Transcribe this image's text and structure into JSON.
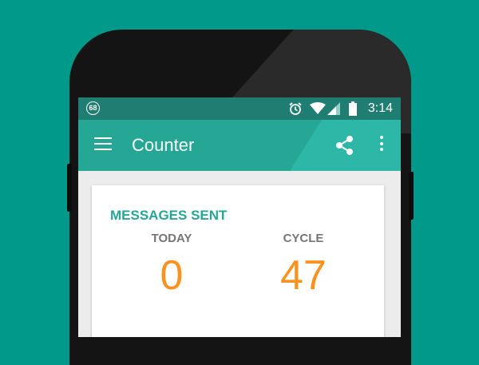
{
  "statusbar": {
    "notification_count": "68",
    "time": "3:14"
  },
  "appbar": {
    "title": "Counter"
  },
  "card": {
    "heading": "MESSAGES SENT",
    "today_label": "TODAY",
    "today_value": "0",
    "cycle_label": "CYCLE",
    "cycle_value": "47"
  },
  "colors": {
    "background": "#00998a",
    "statusbar": "#1f7d72",
    "appbar": "#26a694",
    "heading": "#26a694",
    "value": "#f7931e"
  },
  "icons": {
    "statusbar": [
      "notification-badge-icon",
      "alarm-icon",
      "wifi-icon",
      "signal-icon",
      "battery-icon"
    ],
    "appbar": [
      "menu-icon",
      "share-icon",
      "more-vert-icon"
    ]
  }
}
